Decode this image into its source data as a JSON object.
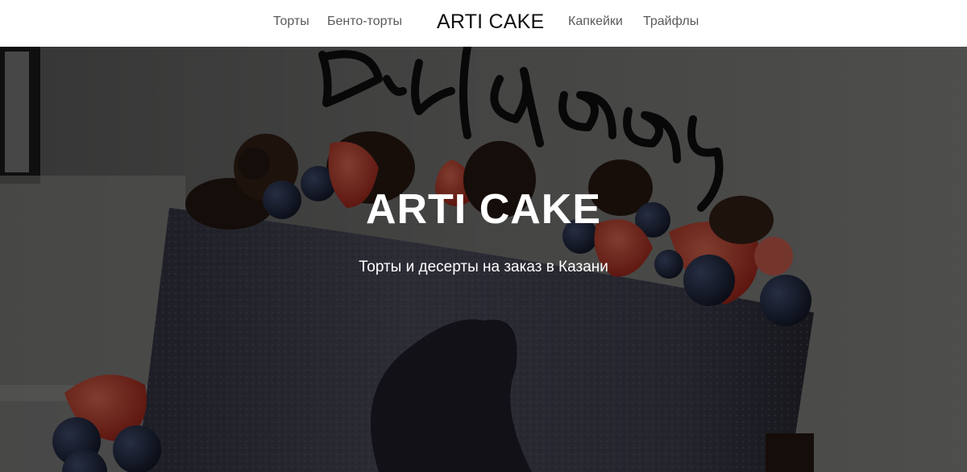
{
  "header": {
    "nav_left": [
      "Торты",
      "Бенто-торты"
    ],
    "logo": "ARTI CAKE",
    "nav_right": [
      "Капкейки",
      "Трайфлы"
    ]
  },
  "hero": {
    "title": "ARTI CAKE",
    "subtitle": "Торты и десерты на заказ в Казани",
    "topper_text": "Birthday",
    "overlay_color": "#000000"
  }
}
